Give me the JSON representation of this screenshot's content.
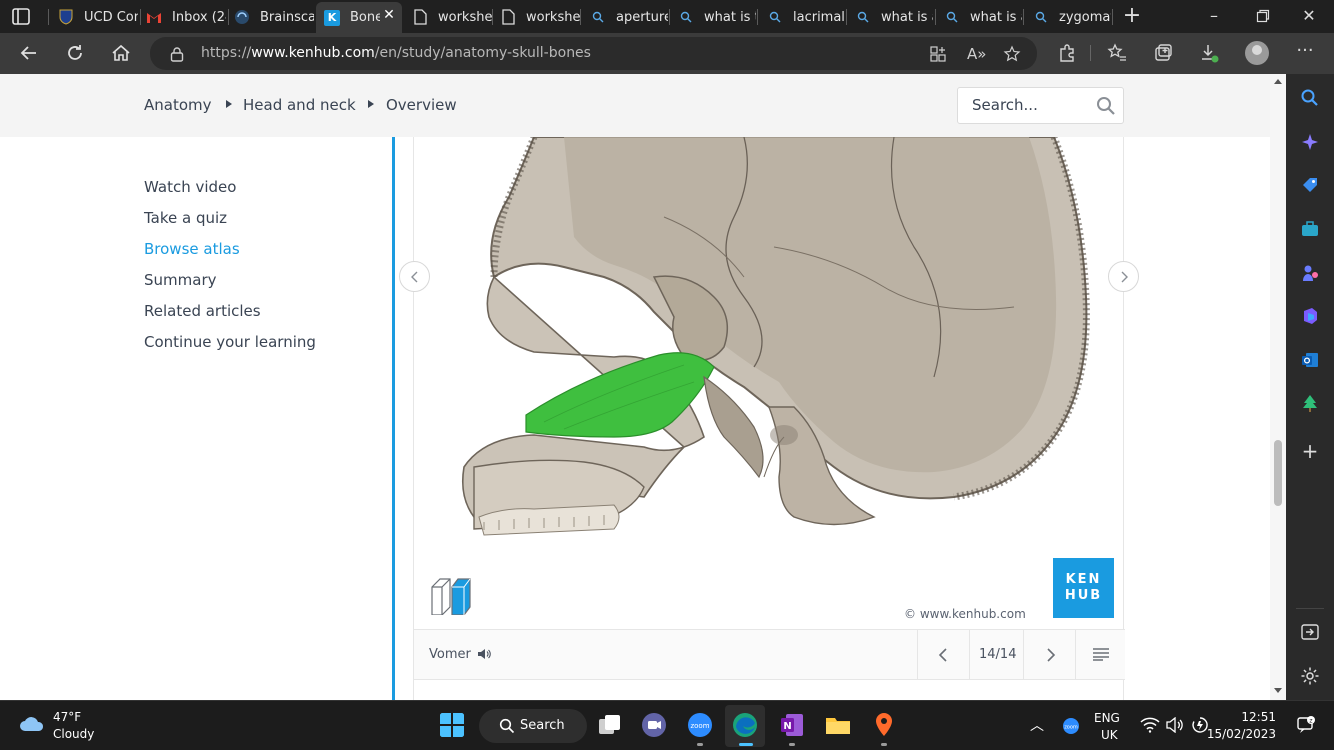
{
  "browser": {
    "tabs": [
      {
        "title": "UCD Con",
        "favicon": "ucd-shield-icon",
        "active": false
      },
      {
        "title": "Inbox (24",
        "favicon": "gmail-icon",
        "active": false
      },
      {
        "title": "Brainscap",
        "favicon": "brainscape-icon",
        "active": false
      },
      {
        "title": "Bone",
        "favicon": "kenhub-icon",
        "active": true
      },
      {
        "title": "workshe",
        "favicon": "document-icon",
        "active": false
      },
      {
        "title": "workshe",
        "favicon": "document-icon",
        "active": false
      },
      {
        "title": "aperture",
        "favicon": "search-icon",
        "active": false
      },
      {
        "title": "what is t",
        "favicon": "search-icon",
        "active": false
      },
      {
        "title": "lacrimal",
        "favicon": "search-icon",
        "active": false
      },
      {
        "title": "what is a",
        "favicon": "search-icon",
        "active": false
      },
      {
        "title": "what is a",
        "favicon": "search-icon",
        "active": false
      },
      {
        "title": "zygomat",
        "favicon": "search-icon",
        "active": false
      }
    ],
    "address": {
      "prefix": "https://",
      "host": "www.kenhub.com",
      "path": "/en/study/anatomy-skull-bones"
    }
  },
  "page": {
    "breadcrumb": [
      "Anatomy",
      "Head and neck",
      "Overview"
    ],
    "search": {
      "placeholder": "Search..."
    },
    "sidenav": [
      {
        "label": "Watch video",
        "active": false
      },
      {
        "label": "Take a quiz",
        "active": false
      },
      {
        "label": "Browse atlas",
        "active": true
      },
      {
        "label": "Summary",
        "active": false
      },
      {
        "label": "Related articles",
        "active": false
      },
      {
        "label": "Continue your learning",
        "active": false
      }
    ],
    "atlas": {
      "logo_line1": "KEN",
      "logo_line2": "HUB",
      "copyright": "© www.kenhub.com",
      "caption": "Vomer",
      "counter": "14/14",
      "highlight_color": "#3fbf3f"
    },
    "accent_color": "#1a9be0"
  },
  "taskbar": {
    "weather": {
      "temp": "47°F",
      "desc": "Cloudy"
    },
    "search_label": "Search",
    "language": {
      "line1": "ENG",
      "line2": "UK"
    },
    "clock": {
      "time": "12:51",
      "date": "15/02/2023"
    }
  }
}
